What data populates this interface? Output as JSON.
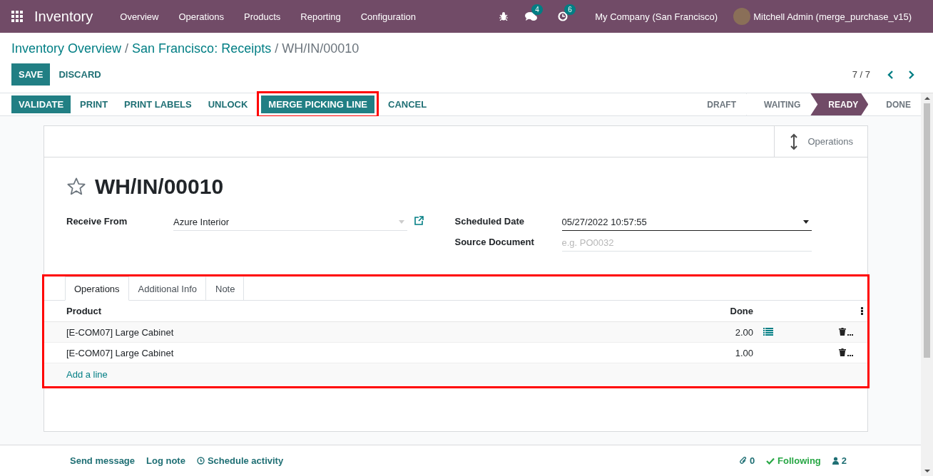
{
  "navbar": {
    "app": "Inventory",
    "menu": [
      "Overview",
      "Operations",
      "Products",
      "Reporting",
      "Configuration"
    ],
    "messages_count": "4",
    "activities_count": "6",
    "company": "My Company (San Francisco)",
    "user": "Mitchell Admin (merge_purchase_v15)"
  },
  "breadcrumb": [
    {
      "label": "Inventory Overview",
      "link": true
    },
    {
      "separator": "/",
      "label": "San Francisco: Receipts",
      "link": true
    },
    {
      "separator": "/",
      "label": "WH/IN/00010",
      "link": false
    }
  ],
  "control_buttons": [
    {
      "label": "SAVE",
      "kind": "primary"
    },
    {
      "label": "DISCARD",
      "kind": "link"
    }
  ],
  "pager": "7 / 7",
  "actions": [
    {
      "label": "VALIDATE",
      "kind": "primary",
      "highlighted": false
    },
    {
      "label": "PRINT",
      "kind": "link",
      "highlighted": false
    },
    {
      "label": "PRINT LABELS",
      "kind": "link",
      "highlighted": false
    },
    {
      "label": "UNLOCK",
      "kind": "link",
      "highlighted": false
    },
    {
      "label": "MERGE PICKING LINE",
      "kind": "primary",
      "highlighted": true
    },
    {
      "label": "CANCEL",
      "kind": "link",
      "highlighted": false
    }
  ],
  "stages": [
    {
      "label": "DRAFT",
      "selected": false
    },
    {
      "label": "WAITING",
      "selected": false
    },
    {
      "label": "READY",
      "selected": true
    },
    {
      "label": "DONE",
      "selected": false
    }
  ],
  "smart_buttons": [
    {
      "label": "Operations"
    }
  ],
  "title": "WH/IN/00010",
  "favorite": false,
  "fields_left": [
    {
      "label": "Receive From",
      "kind": "many2one",
      "value": "Azure Interior"
    }
  ],
  "fields_right": [
    {
      "label": "Scheduled Date",
      "kind": "datetime",
      "value": "05/27/2022 10:57:55",
      "focused": true
    },
    {
      "label": "Source Document",
      "kind": "char",
      "placeholder": "e.g. PO0032",
      "focused": false
    }
  ],
  "notebook": {
    "highlighted": true,
    "tabs": [
      {
        "label": "Operations",
        "selected": true
      },
      {
        "label": "Additional Info",
        "selected": false
      },
      {
        "label": "Note",
        "selected": false
      }
    ],
    "columns": [
      "Product",
      "Done"
    ],
    "rows": [
      {
        "product": "[E-COM07] Large Cabinet",
        "done": "2.00",
        "details": true
      },
      {
        "product": "[E-COM07] Large Cabinet",
        "done": "1.00",
        "details": false
      }
    ],
    "add_line": "Add a line"
  },
  "chatter": {
    "send_message": "Send message",
    "log_note": "Log note",
    "schedule_activity": "Schedule activity",
    "attachments": "0",
    "following": "Following",
    "followers": "2"
  }
}
